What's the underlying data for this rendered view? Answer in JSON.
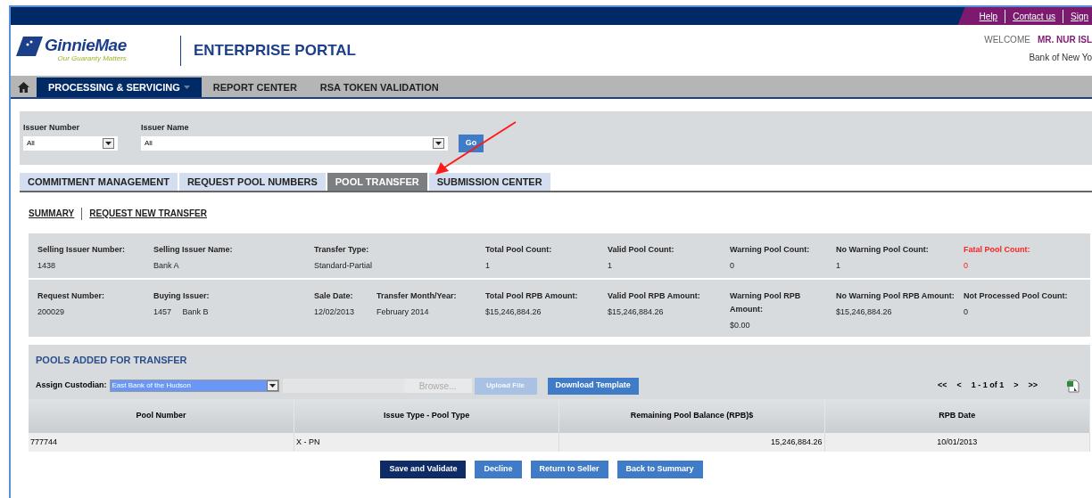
{
  "top_links": [
    {
      "label": "Help"
    },
    {
      "label": "Contact us"
    },
    {
      "label": "Sign"
    }
  ],
  "logo": {
    "name": "GinnieMae",
    "tagline": "Our Guaranty Matters"
  },
  "portal_title": "ENTERPRISE PORTAL",
  "welcome": {
    "label": "WELCOME",
    "user": "MR. NUR ISL",
    "bank": "Bank of New Yo"
  },
  "nav": [
    {
      "label": "PROCESSING & SERVICING",
      "selected": true,
      "dropdown": true
    },
    {
      "label": "REPORT CENTER",
      "selected": false,
      "dropdown": false
    },
    {
      "label": "RSA TOKEN VALIDATION",
      "selected": false,
      "dropdown": false
    }
  ],
  "filters": [
    {
      "label": "Issuer Number",
      "value": "All"
    },
    {
      "label": "Issuer Name",
      "value": "All"
    }
  ],
  "go_button": "Go",
  "tabs": [
    {
      "label": "COMMITMENT MANAGEMENT",
      "selected": false
    },
    {
      "label": "REQUEST POOL NUMBERS",
      "selected": false
    },
    {
      "label": "POOL TRANSFER",
      "selected": true
    },
    {
      "label": "SUBMISSION CENTER",
      "selected": false
    }
  ],
  "sub_links": [
    {
      "label": "SUMMARY"
    },
    {
      "label": "REQUEST NEW TRANSFER"
    }
  ],
  "summary_rows": [
    [
      {
        "label": "Selling Issuer Number:",
        "value": "1438",
        "alert": false
      },
      {
        "label": "Selling Issuer Name:",
        "value": "Bank A",
        "alert": false
      },
      {
        "label": "Transfer Type:",
        "value": "Standard-Partial",
        "alert": false
      },
      {
        "label": "Total Pool Count:",
        "value": "1",
        "alert": false
      },
      {
        "label": "Valid Pool Count:",
        "value": "1",
        "alert": false
      },
      {
        "label": "Warning Pool Count:",
        "value": "0",
        "alert": false
      },
      {
        "label": "No Warning Pool Count:",
        "value": "1",
        "alert": false
      },
      {
        "label": "Fatal Pool Count:",
        "value": "0",
        "alert": true
      }
    ],
    [
      {
        "label": "Request Number:",
        "value": "200029",
        "alert": false
      },
      {
        "label": "Buying Issuer:",
        "value": "1457     Bank B",
        "alert": false
      },
      {
        "label": "Sale Date:",
        "value": "12/02/2013",
        "alert": false
      },
      {
        "label": "Transfer Month/Year:",
        "value": "February 2014",
        "alert": false
      },
      {
        "label": "Total Pool RPB Amount:",
        "value": "$15,246,884.26",
        "alert": false
      },
      {
        "label": "Valid Pool RPB Amount:",
        "value": "$15,246,884.26",
        "alert": false
      },
      {
        "label": "Warning Pool RPB Amount:",
        "value": "$0.00",
        "alert": false
      },
      {
        "label": "No Warning Pool RPB Amount:",
        "value": "$15,246,884.26",
        "alert": false
      },
      {
        "label": "Not Processed Pool Count:",
        "value": "0",
        "alert": false
      }
    ]
  ],
  "pools": {
    "title": "POOLS ADDED FOR TRANSFER",
    "custodian": {
      "label": "Assign Custodian:",
      "value": "East Bank of the Hudson"
    },
    "browse": {
      "label": "Browse...",
      "disabled": true
    },
    "upload": {
      "label": "Upload File",
      "disabled": true
    },
    "download": {
      "label": "Download Template",
      "disabled": false
    },
    "pager": [
      "<<",
      "<",
      "1 - 1 of 1",
      ">",
      ">>"
    ],
    "columns": [
      "Pool Number",
      "Issue Type - Pool Type",
      "Remaining Pool Balance (RPB)$",
      "RPB Date"
    ],
    "rows": [
      [
        "777744",
        "X - PN",
        "15,246,884.26",
        "10/01/2013"
      ]
    ]
  },
  "actions": [
    {
      "label": "Save and Validate",
      "kind": "primary"
    },
    {
      "label": "Decline",
      "kind": "secondary"
    },
    {
      "label": "Return to Seller",
      "kind": "secondary"
    },
    {
      "label": "Back to Summary",
      "kind": "secondary"
    }
  ]
}
